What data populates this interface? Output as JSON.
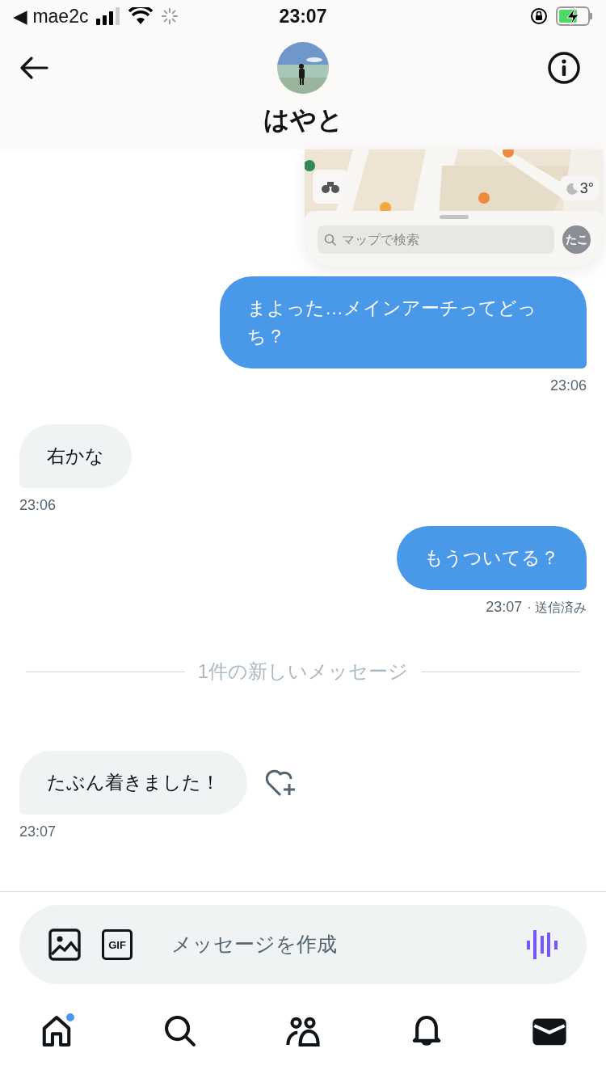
{
  "status_bar": {
    "back_app": "◀ mae2c",
    "time": "23:07"
  },
  "header": {
    "name": "はやと"
  },
  "attachment": {
    "weather": "3°",
    "search_placeholder": "マップで検索",
    "account": "たこ"
  },
  "messages": [
    {
      "kind": "sent",
      "text": "まよった…メインアーチってどっち？",
      "time": "23:06"
    },
    {
      "kind": "received",
      "text": "右かな",
      "time": "23:06"
    },
    {
      "kind": "sent",
      "text": "もうついてる？",
      "time": "23:07",
      "status": "· 送信済み"
    },
    {
      "kind": "divider",
      "text": "1件の新しいメッセージ"
    },
    {
      "kind": "received",
      "text": "たぶん着きました！",
      "time": "23:07",
      "reaction_button": true
    }
  ],
  "composer": {
    "gif": "GIF",
    "placeholder": "メッセージを作成"
  },
  "tabs": [
    {
      "kind": "home",
      "selected": false,
      "badge": true
    },
    {
      "kind": "search",
      "selected": false
    },
    {
      "kind": "people",
      "selected": false
    },
    {
      "kind": "bell",
      "selected": false
    },
    {
      "kind": "mail",
      "selected": true
    }
  ]
}
